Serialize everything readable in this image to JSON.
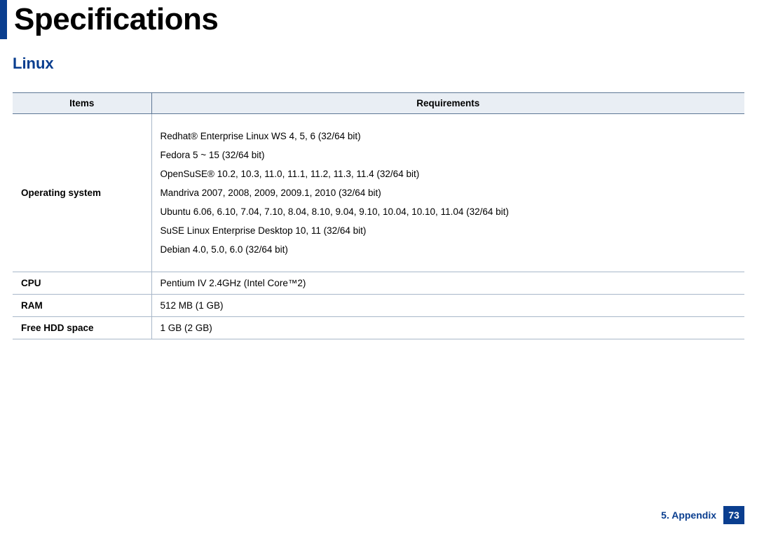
{
  "page": {
    "title": "Specifications",
    "section": "Linux"
  },
  "table": {
    "headers": {
      "items": "Items",
      "requirements": "Requirements"
    },
    "rows": {
      "os": {
        "label": "Operating system",
        "lines": [
          "Redhat® Enterprise Linux WS 4, 5, 6 (32/64 bit)",
          "Fedora 5 ~ 15 (32/64 bit)",
          "OpenSuSE® 10.2, 10.3, 11.0, 11.1, 11.2, 11.3, 11.4 (32/64 bit)",
          "Mandriva 2007, 2008, 2009, 2009.1, 2010 (32/64 bit)",
          "Ubuntu 6.06, 6.10, 7.04, 7.10, 8.04, 8.10, 9.04, 9.10, 10.04, 10.10, 11.04 (32/64 bit)",
          "SuSE Linux Enterprise Desktop 10, 11 (32/64 bit)",
          "Debian 4.0, 5.0, 6.0 (32/64 bit)"
        ]
      },
      "cpu": {
        "label": "CPU",
        "value": "Pentium IV 2.4GHz (Intel Core™2)"
      },
      "ram": {
        "label": "RAM",
        "value": "512 MB (1 GB)"
      },
      "hdd": {
        "label": "Free HDD space",
        "value": "1 GB (2 GB)"
      }
    }
  },
  "footer": {
    "chapter": "5. Appendix",
    "page_number": "73"
  }
}
